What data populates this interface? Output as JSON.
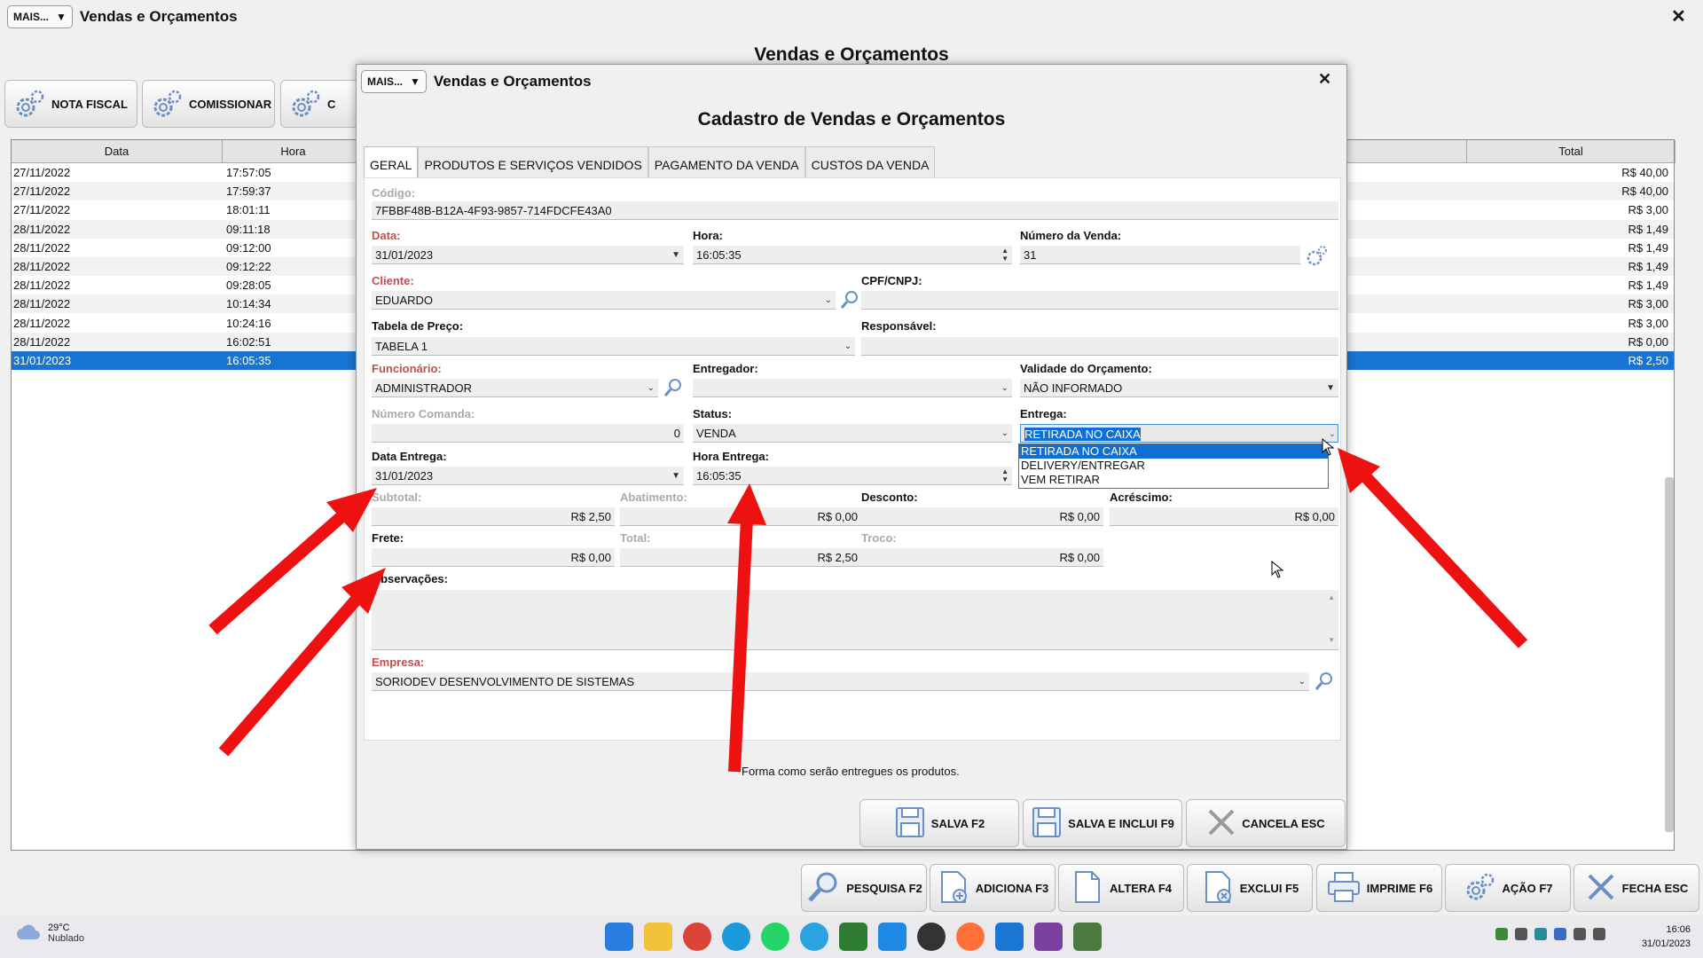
{
  "main": {
    "mais_label": "MAIS...",
    "title": "Vendas e Orçamentos",
    "heading": "Vendas e Orçamentos",
    "close": "✕",
    "toolbar": {
      "nota_fiscal": "NOTA FISCAL",
      "comissionar": "COMISSIONAR",
      "third": "C"
    },
    "table": {
      "headers": [
        "Data",
        "Hora",
        "Total"
      ],
      "rows": [
        {
          "data": "27/11/2022",
          "hora": "17:57:05",
          "total": "R$ 40,00"
        },
        {
          "data": "27/11/2022",
          "hora": "17:59:37",
          "total": "R$ 40,00"
        },
        {
          "data": "27/11/2022",
          "hora": "18:01:11",
          "total": "R$ 3,00"
        },
        {
          "data": "28/11/2022",
          "hora": "09:11:18",
          "total": "R$ 1,49"
        },
        {
          "data": "28/11/2022",
          "hora": "09:12:00",
          "total": "R$ 1,49"
        },
        {
          "data": "28/11/2022",
          "hora": "09:12:22",
          "total": "R$ 1,49"
        },
        {
          "data": "28/11/2022",
          "hora": "09:28:05",
          "total": "R$ 1,49"
        },
        {
          "data": "28/11/2022",
          "hora": "10:14:34",
          "total": "R$ 3,00"
        },
        {
          "data": "28/11/2022",
          "hora": "10:24:16",
          "total": "R$ 3,00"
        },
        {
          "data": "28/11/2022",
          "hora": "16:02:51",
          "total": "R$ 0,00"
        },
        {
          "data": "31/01/2023",
          "hora": "16:05:35",
          "total": "R$ 2,50"
        }
      ]
    },
    "bottom_buttons": {
      "pesquisa": "PESQUISA F2",
      "adiciona": "ADICIONA F3",
      "altera": "ALTERA F4",
      "exclui": "EXCLUI F5",
      "imprime": "IMPRIME F6",
      "acao": "AÇÃO F7",
      "fecha": "FECHA ESC"
    }
  },
  "dialog": {
    "mais_label": "MAIS...",
    "title": "Vendas e Orçamentos",
    "close": "✕",
    "heading": "Cadastro de Vendas e Orçamentos",
    "tabs": [
      "GERAL",
      "PRODUTOS E SERVIÇOS VENDIDOS",
      "PAGAMENTO DA VENDA",
      "CUSTOS DA VENDA"
    ],
    "fields": {
      "codigo_label": "Código:",
      "codigo_value": "7FBBF48B-B12A-4F93-9857-714FDCFE43A0",
      "data_label": "Data:",
      "data_value": "31/01/2023",
      "hora_label": "Hora:",
      "hora_value": "16:05:35",
      "numero_venda_label": "Número da Venda:",
      "numero_venda_value": "31",
      "cliente_label": "Cliente:",
      "cliente_value": "EDUARDO",
      "cpf_label": "CPF/CNPJ:",
      "cpf_value": "",
      "tabela_label": "Tabela de Preço:",
      "tabela_value": "TABELA 1",
      "responsavel_label": "Responsável:",
      "responsavel_value": "",
      "funcionario_label": "Funcionário:",
      "funcionario_value": "ADMINISTRADOR",
      "entregador_label": "Entregador:",
      "entregador_value": "",
      "validade_label": "Validade do Orçamento:",
      "validade_value": "NÃO INFORMADO",
      "comanda_label": "Número Comanda:",
      "comanda_value": "0",
      "status_label": "Status:",
      "status_value": "VENDA",
      "entrega_label": "Entrega:",
      "entrega_value": "RETIRADA NO CAIXA",
      "data_entrega_label": "Data Entrega:",
      "data_entrega_value": "31/01/2023",
      "hora_entrega_label": "Hora Entrega:",
      "hora_entrega_value": "16:05:35",
      "subtotal_label": "Subtotal:",
      "subtotal_value": "R$ 2,50",
      "abatimento_label": "Abatimento:",
      "abatimento_value": "R$ 0,00",
      "desconto_label": "Desconto:",
      "desconto_value": "R$ 0,00",
      "acrescimo_label": "Acréscimo:",
      "acrescimo_value": "R$ 0,00",
      "frete_label": "Frete:",
      "frete_value": "R$ 0,00",
      "total_label": "Total:",
      "total_value": "R$ 2,50",
      "troco_label": "Troco:",
      "troco_value": "R$ 0,00",
      "observacoes_label": "Observações:",
      "empresa_label": "Empresa:",
      "empresa_value": "SORIODEV DESENVOLVIMENTO DE SISTEMAS"
    },
    "entrega_options": [
      "RETIRADA NO CAIXA",
      "DELIVERY/ENTREGAR",
      "VEM RETIRAR"
    ],
    "hint": "Forma como serão entregues os produtos.",
    "buttons": {
      "salva": "SALVA F2",
      "salva_inclui": "SALVA E INCLUI F9",
      "cancela": "CANCELA ESC"
    }
  },
  "taskbar": {
    "weather_temp": "29°C",
    "weather_desc": "Nublado",
    "time": "16:06",
    "date": "31/01/2023"
  },
  "colors": {
    "selection": "#1874d3",
    "required_label": "#c0504d",
    "annotation_arrow": "#ee1111"
  }
}
